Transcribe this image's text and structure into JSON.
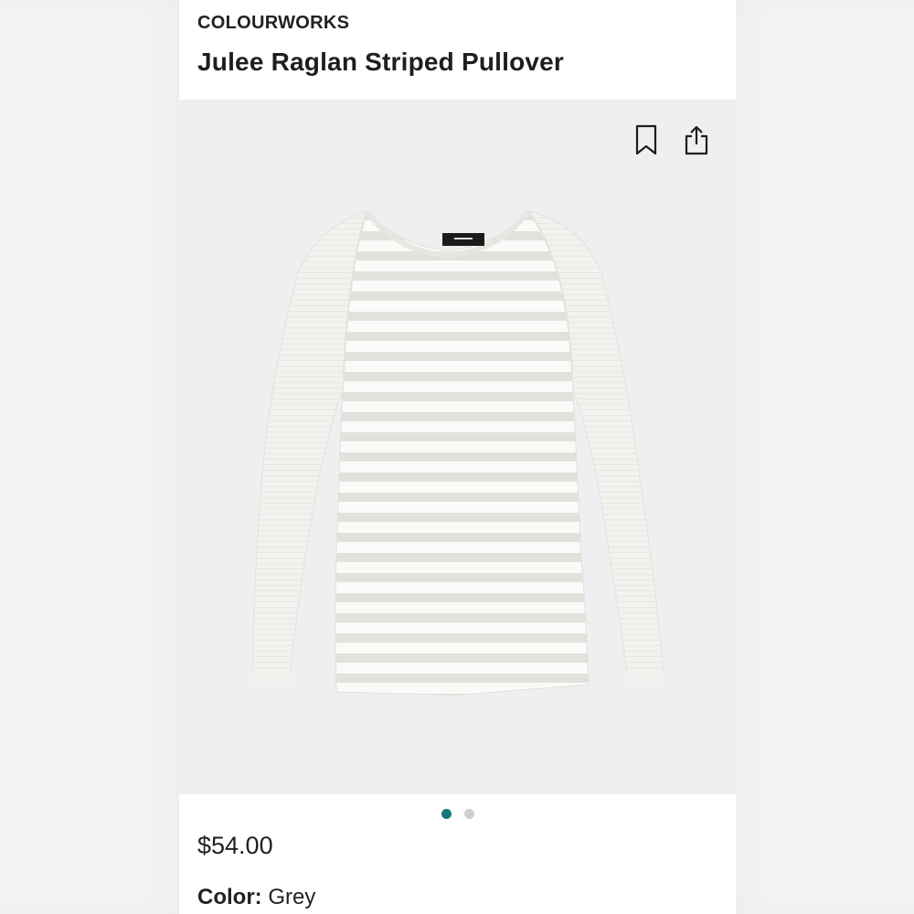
{
  "product": {
    "brand": "COLOURWORKS",
    "title": "Julee Raglan Striped Pullover",
    "price": "$54.00",
    "color_label": "Color:",
    "color_value": "Grey"
  },
  "gallery": {
    "image_description_icon": "sweater-photo",
    "slides_total": 2,
    "active_slide": 1
  },
  "icons": {
    "bookmark": "bookmark-icon",
    "share": "share-icon"
  },
  "colors": {
    "accent_dot": "#17777a",
    "inactive_dot": "#cfcfd2",
    "image_bg": "#efeff1"
  }
}
